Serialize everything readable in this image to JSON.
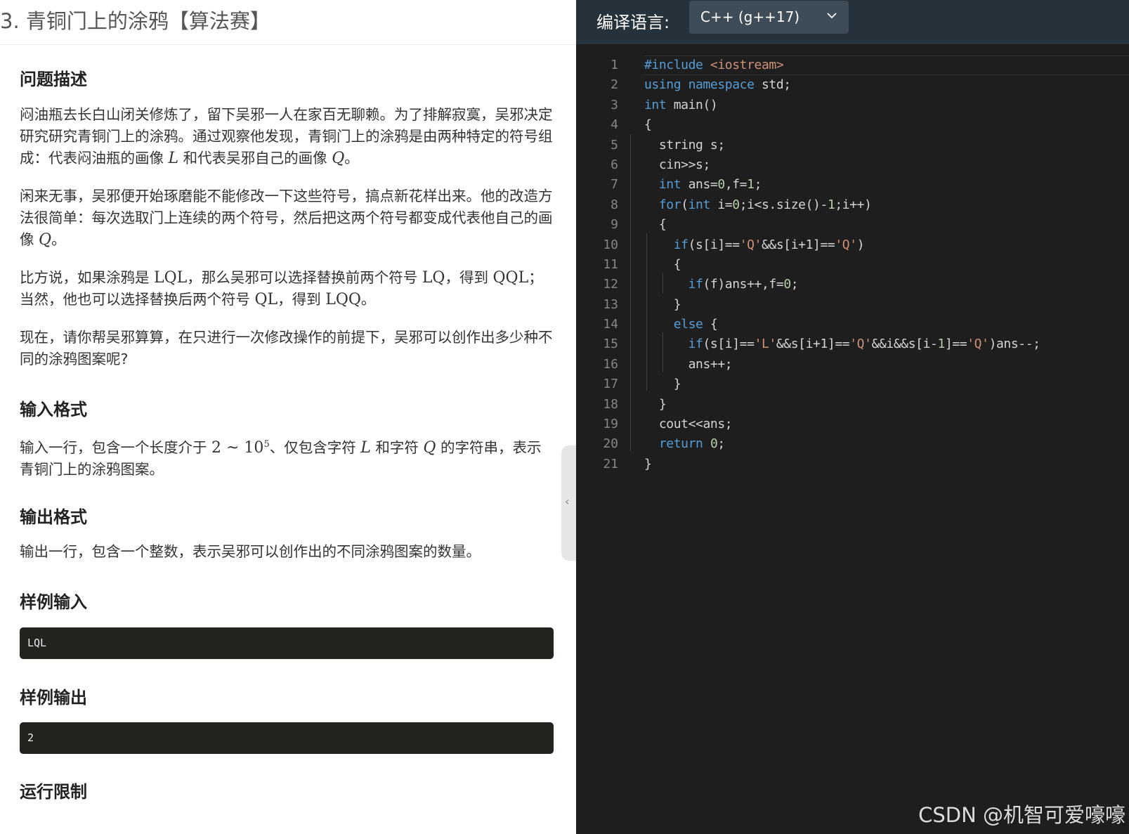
{
  "problem": {
    "title": "3. 青铜门上的涂鸦【算法赛】",
    "desc_heading": "问题描述",
    "p1": {
      "a": "闷油瓶去长白山闭关修炼了，留下吴邪一人在家百无聊赖。为了排解寂寞，吴邪决定研究研究青铜门上的涂鸦。通过观察他发现，青铜门上的涂鸦是由两种特定的符号组成：代表闷油瓶的画像 ",
      "m1": "L",
      "b": " 和代表吴邪自己的画像 ",
      "m2": "Q",
      "c": "。"
    },
    "p2": {
      "a": "闲来无事，吴邪便开始琢磨能不能修改一下这些符号，搞点新花样出来。他的改造方法很简单：每次选取门上连续的两个符号，然后把这两个符号都变成代表他自己的画像 ",
      "m1": "Q",
      "c": "。"
    },
    "p3": {
      "a": "比方说，如果涂鸦是 ",
      "m1": "LQL",
      "b": "，那么吴邪可以选择替换前两个符号 ",
      "m2": "LQ",
      "c": "，得到 ",
      "m3": "QQL",
      "d": "；当然，他也可以选择替换后两个符号 ",
      "m4": "QL",
      "e": "，得到 ",
      "m5": "LQQ",
      "f": "。"
    },
    "p4": "现在，请你帮吴邪算算，在只进行一次修改操作的前提下，吴邪可以创作出多少种不同的涂鸦图案呢?",
    "input_heading": "输入格式",
    "p5": {
      "a": "输入一行，包含一个长度介于 ",
      "m1": "2 ~ 10",
      "m1sup": "5",
      "b": "、仅包含字符 ",
      "m2": "L",
      "c": " 和字符 ",
      "m3": "Q",
      "d": " 的字符串，表示青铜门上的涂鸦图案。"
    },
    "output_heading": "输出格式",
    "p6": "输出一行，包含一个整数，表示吴邪可以创作出的不同涂鸦图案的数量。",
    "sample_input_heading": "样例输入",
    "sample_input": "LQL",
    "sample_output_heading": "样例输出",
    "sample_output": "2",
    "limit_heading": "运行限制"
  },
  "editor": {
    "lang_label": "编译语言:",
    "lang_value": "C++ (g++17)",
    "lines": [
      "1",
      "2",
      "3",
      "4",
      "5",
      "6",
      "7",
      "8",
      "9",
      "10",
      "11",
      "12",
      "13",
      "14",
      "15",
      "16",
      "17",
      "18",
      "19",
      "20",
      "21"
    ],
    "code": [
      [
        [
          "pre",
          "#include "
        ],
        [
          "str",
          "<iostream>"
        ]
      ],
      [
        [
          "kw",
          "using"
        ],
        [
          "t",
          " "
        ],
        [
          "kw",
          "namespace"
        ],
        [
          "t",
          " std;"
        ]
      ],
      [
        [
          "kw",
          "int"
        ],
        [
          "t",
          " main()"
        ]
      ],
      [
        [
          "t",
          "{"
        ]
      ],
      [
        [
          "t",
          "  string s;"
        ]
      ],
      [
        [
          "t",
          "  cin>>s;"
        ]
      ],
      [
        [
          "t",
          "  "
        ],
        [
          "kw",
          "int"
        ],
        [
          "t",
          " ans="
        ],
        [
          "num",
          "0"
        ],
        [
          "t",
          ",f="
        ],
        [
          "num",
          "1"
        ],
        [
          "t",
          ";"
        ]
      ],
      [
        [
          "t",
          "  "
        ],
        [
          "kw",
          "for"
        ],
        [
          "t",
          "("
        ],
        [
          "kw",
          "int"
        ],
        [
          "t",
          " i="
        ],
        [
          "num",
          "0"
        ],
        [
          "t",
          ";i<s.size()-"
        ],
        [
          "num",
          "1"
        ],
        [
          "t",
          ";i++)"
        ]
      ],
      [
        [
          "t",
          "  {"
        ]
      ],
      [
        [
          "t",
          "    "
        ],
        [
          "kw",
          "if"
        ],
        [
          "t",
          "(s[i]=="
        ],
        [
          "str",
          "'Q'"
        ],
        [
          "t",
          "&&s[i+1]=="
        ],
        [
          "str",
          "'Q'"
        ],
        [
          "t",
          ")"
        ]
      ],
      [
        [
          "t",
          "    {"
        ]
      ],
      [
        [
          "t",
          "      "
        ],
        [
          "kw",
          "if"
        ],
        [
          "t",
          "(f)ans++,f="
        ],
        [
          "num",
          "0"
        ],
        [
          "t",
          ";"
        ]
      ],
      [
        [
          "t",
          "    }"
        ]
      ],
      [
        [
          "t",
          "    "
        ],
        [
          "kw",
          "else"
        ],
        [
          "t",
          " {"
        ]
      ],
      [
        [
          "t",
          "      "
        ],
        [
          "kw",
          "if"
        ],
        [
          "t",
          "(s[i]=="
        ],
        [
          "str",
          "'L'"
        ],
        [
          "t",
          "&&s[i+1]=="
        ],
        [
          "str",
          "'Q'"
        ],
        [
          "t",
          "&&i&&s[i-"
        ],
        [
          "num",
          "1"
        ],
        [
          "t",
          "]=="
        ],
        [
          "str",
          "'Q'"
        ],
        [
          "t",
          ")ans--;"
        ]
      ],
      [
        [
          "t",
          "      ans++;"
        ]
      ],
      [
        [
          "t",
          "    }"
        ]
      ],
      [
        [
          "t",
          "  }"
        ]
      ],
      [
        [
          "t",
          "  cout<<ans;"
        ]
      ],
      [
        [
          "t",
          "  "
        ],
        [
          "kw",
          "return"
        ],
        [
          "t",
          " "
        ],
        [
          "num",
          "0"
        ],
        [
          "t",
          ";"
        ]
      ],
      [
        [
          "t",
          "}"
        ]
      ]
    ]
  },
  "watermark": "CSDN @机智可爱嚎嚎"
}
